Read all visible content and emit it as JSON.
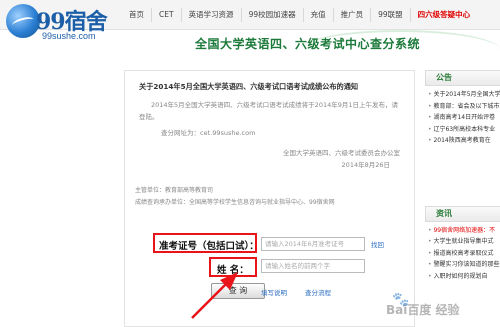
{
  "brand": {
    "logo_text": "99宿舍",
    "url": "99sushe.com"
  },
  "nav": {
    "items": [
      "首页",
      "CET",
      "英语学习资源",
      "99校园加速器",
      "充值",
      "推广员",
      "99联盟",
      "四六级答疑中心"
    ]
  },
  "banner": {
    "title": "全国大学英语四、六级考试中心查分系统"
  },
  "notice": {
    "title": "关于2014年5月全国大学英语四、六级考试口语考试成绩公布的通知",
    "body": "2014年5月全国大学英语四、六级考试口语考试成绩将于2014年9月1日上午发布，请登陆。",
    "link": "查分网址为：cet.99sushe.com",
    "signature_org": "全国大学英语四、六级考试委员会办公室",
    "signature_date": "2014年8月26日",
    "sponsor": "主管单位：教育部高等教育司",
    "cohost": "成绩查询承办单位：全国高等学校学生信息咨询与就业指导中心、99宿舍网"
  },
  "form": {
    "ticket_label": "准考证号（包括口试）：",
    "ticket_placeholder": "请输入2014年6月准考证号",
    "retrieve_link": "找回",
    "name_label": "姓    名：",
    "name_placeholder": "请输入姓名的前两个字",
    "query_button": "查 询",
    "help_link": "填写说明",
    "process_link": "查分流程"
  },
  "sidebar": {
    "notice_heading": "公告",
    "notice_items": [
      "关于2014年5月全国大学",
      "教育部：省会及以下城市",
      "湖南高考14日开始评卷",
      "辽宁63所高校本科专业",
      "2014陕西高考教育在"
    ],
    "info_heading": "资讯",
    "info_items": [
      "99宿舍网络加速器：不",
      "大学生就业指导集中式",
      "报道高校高考录取仪式",
      "警醒实习你该知道的那些",
      "入职时如何的规划自"
    ]
  },
  "watermark": "Bai百度 经验",
  "colors": {
    "highlight_red": "#e8141a",
    "brand_blue": "#1c5fa8",
    "banner_green": "#1c7a3a"
  }
}
